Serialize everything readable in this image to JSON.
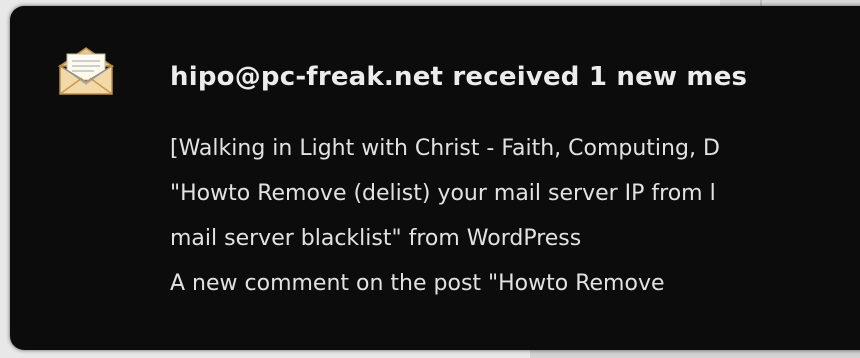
{
  "notification": {
    "icon": "mail-envelope-icon",
    "summary": "hipo@pc-freak.net received 1 new mes",
    "body_lines": [
      "[Walking in Light with Christ - Faith, Computing, D",
      "\"Howto Remove (delist) your mail server IP from l",
      "mail server blacklist\" from WordPress",
      "A new comment on the post \"Howto Remove"
    ]
  },
  "colors": {
    "popup_background": "#0c0c0c",
    "summary_text": "#ececec",
    "body_text": "#e2e2e2",
    "envelope": "#f3d9a8"
  }
}
